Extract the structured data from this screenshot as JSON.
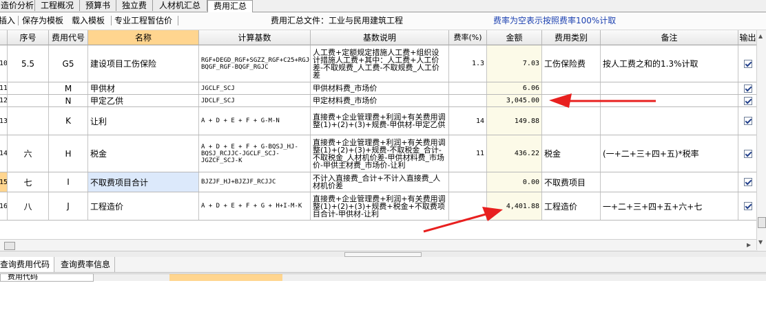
{
  "tabs": [
    "造价分析",
    "工程概况",
    "预算书",
    "独立费",
    "人材机汇总",
    "费用汇总"
  ],
  "toolbar": {
    "insert": "插入",
    "save_template": "保存为模板",
    "load_template": "载入模板",
    "provisional": "专业工程暂估价",
    "file_label": "费用汇总文件：工业与民用建筑工程",
    "rate_hint": "费率为空表示按照费率100%计取"
  },
  "columns": [
    "序号",
    "费用代号",
    "名称",
    "计算基数",
    "基数说明",
    "费率(%)",
    "金额",
    "费用类别",
    "备注",
    "输出"
  ],
  "rows": [
    {
      "idx": "10",
      "no": "5.5",
      "code": "G5",
      "name": "建设项目工伤保险",
      "base": "RGF+DEGD_RGF+SGZZ_RGF+C25+RGJC-BQGF_RGF-BQGF_RGJC",
      "desc": "人工费+定额规定措施人工费+组织设计措施人工费+其中：人工费+人工价差-不取规费_人工费-不取规费_人工价差",
      "rate": "1.3",
      "amount": "7.03",
      "category": "工伤保险费",
      "remark": "按人工费之和的1.3%计取",
      "output": true
    },
    {
      "idx": "11",
      "no": "",
      "code": "M",
      "name": "甲供材",
      "base": "JGCLF_SCJ",
      "desc": "甲供材料费_市场价",
      "rate": "",
      "amount": "6.06",
      "category": "",
      "remark": "",
      "output": true
    },
    {
      "idx": "12",
      "no": "",
      "code": "N",
      "name": "甲定乙供",
      "base": "JDCLF_SCJ",
      "desc": "甲定材料费_市场价",
      "rate": "",
      "amount": "3,045.00",
      "category": "",
      "remark": "",
      "output": true
    },
    {
      "idx": "13",
      "no": "",
      "code": "K",
      "name": "让利",
      "base": "A + D + E + F + G-M-N",
      "desc": "直接费+企业管理费+利润+有关费用调整(1)+(2)+(3)+规费-甲供材-甲定乙供",
      "rate": "14",
      "amount": "149.88",
      "category": "",
      "remark": "",
      "output": true
    },
    {
      "idx": "14",
      "no": "六",
      "code": "H",
      "name": "税金",
      "base": "A + D + E + F + G-BQSJ_HJ-BQSJ_RCJJC-JGCLF_SCJ-JGZCF_SCJ-K",
      "desc": "直接费+企业管理费+利润+有关费用调整(1)+(2)+(3)+规费-不取税金_合计-不取税金_人材机价差-甲供材料费_市场价-甲供主材费_市场价-让利",
      "rate": "11",
      "amount": "436.22",
      "category": "税金",
      "remark": "(一+二+三+四+五)*税率",
      "output": true
    },
    {
      "idx": "15",
      "no": "七",
      "code": "I",
      "name": "不取费项目合计",
      "base": "BJZJF_HJ+BJZJF_RCJJC",
      "desc": "不计入直接费_合计+不计入直接费_人材机价差",
      "rate": "",
      "amount": "0.00",
      "category": "不取费项目",
      "remark": "",
      "output": true
    },
    {
      "idx": "16",
      "no": "八",
      "code": "J",
      "name": "工程造价",
      "base": "A + D + E + F + G + H+I-M-K",
      "desc": "直接费+企业管理费+利润+有关费用调整(1)+(2)+(3)+规费+税金+不取费项目合计-甲供材-让利",
      "rate": "",
      "amount": "4,401.88",
      "category": "工程造价",
      "remark": "一+二+三+四+五+六+七",
      "output": true
    }
  ],
  "bottom_tabs": [
    "查询费用代码",
    "查询费率信息"
  ],
  "bottom_panel": {
    "header": "费用代码"
  },
  "colors": {
    "accent_header": "#ffd58f",
    "arrow": "#e8201f",
    "hint_text": "#1a3fb0",
    "money_bg": "#fcfae8",
    "selected_name_bg": "#dce9fb"
  }
}
